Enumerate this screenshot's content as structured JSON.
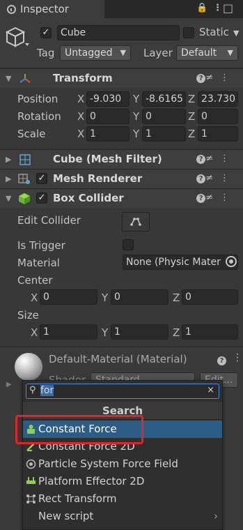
{
  "tab": {
    "title": "Inspector"
  },
  "object": {
    "name": "Cube",
    "static_label": "Static",
    "tag_label": "Tag",
    "tag_value": "Untagged",
    "layer_label": "Layer",
    "layer_value": "Default"
  },
  "transform": {
    "title": "Transform",
    "position_label": "Position",
    "rotation_label": "Rotation",
    "scale_label": "Scale",
    "position": {
      "x": "-9.030",
      "y": "-8.6165",
      "z": "23.730"
    },
    "rotation": {
      "x": "0",
      "y": "0",
      "z": "0"
    },
    "scale": {
      "x": "1",
      "y": "1",
      "z": "1"
    }
  },
  "axes": {
    "x": "X",
    "y": "Y",
    "z": "Z"
  },
  "mesh_filter": {
    "title": "Cube (Mesh Filter)"
  },
  "mesh_renderer": {
    "title": "Mesh Renderer"
  },
  "box_collider": {
    "title": "Box Collider",
    "edit_collider_label": "Edit Collider",
    "is_trigger_label": "Is Trigger",
    "material_label": "Material",
    "material_value": "None (Physic Mater",
    "center_label": "Center",
    "center": {
      "x": "0",
      "y": "0",
      "z": "0"
    },
    "size_label": "Size",
    "size": {
      "x": "1",
      "y": "1",
      "z": "1"
    }
  },
  "material": {
    "title": "Default-Material (Material)",
    "shader_label": "Shader",
    "shader_value": "Standard",
    "edit_label": "Edit..."
  },
  "popup": {
    "search_value": "for",
    "header": "Search",
    "items": [
      {
        "label": "Constant Force",
        "icon": "constant-force-icon"
      },
      {
        "label": "Constant Force 2D",
        "icon": "constant-force-2d-icon"
      },
      {
        "label": "Particle System Force Field",
        "icon": "particle-force-field-icon"
      },
      {
        "label": "Platform Effector 2D",
        "icon": "platform-effector-icon"
      },
      {
        "label": "Rect Transform",
        "icon": "rect-transform-icon"
      },
      {
        "label": "New script",
        "icon": ""
      }
    ]
  },
  "colors": {
    "selection": "#2c5d87",
    "highlight_box": "#e0252a",
    "focus": "#4a8ee8"
  }
}
